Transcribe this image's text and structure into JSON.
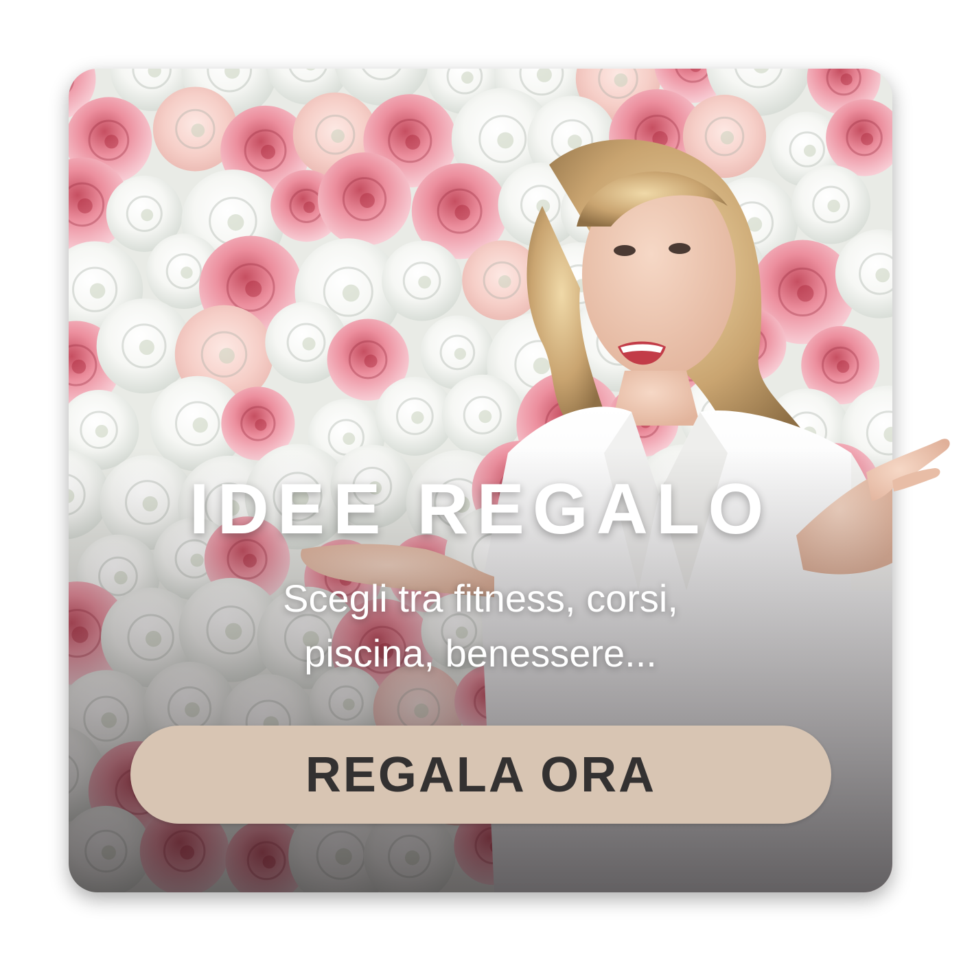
{
  "promo": {
    "headline": "IDEE REGALO",
    "subtitle_lines": [
      "Scegli tra fitness, corsi,",
      "piscina, benessere..."
    ],
    "cta_label": "REGALA ORA"
  },
  "colors": {
    "page_bg": "#ffffff",
    "cta_bg": "#d8c5b3",
    "cta_text": "#333131",
    "headline_text": "#ffffff"
  },
  "image": {
    "content": "flower-wall-woman-photo"
  }
}
